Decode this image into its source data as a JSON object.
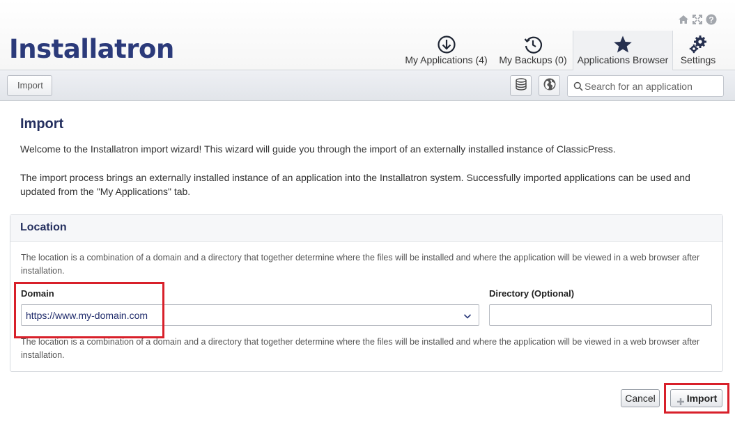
{
  "app": {
    "logo_text": "Installatron"
  },
  "tabs": [
    {
      "label": "My Applications (4)",
      "icon": "download-circle-icon"
    },
    {
      "label": "My Backups (0)",
      "icon": "history-clock-icon"
    },
    {
      "label": "Applications Browser",
      "icon": "star-icon",
      "active": true
    },
    {
      "label": "Settings",
      "icon": "gears-icon"
    }
  ],
  "top_icons": [
    "home-icon",
    "fullscreen-icon",
    "help-icon"
  ],
  "toolbar": {
    "breadcrumb": "Import",
    "db_button_icon": "database-icon",
    "language_button_icon": "globe-icon",
    "search_placeholder": "Search for an application"
  },
  "page": {
    "title": "Import",
    "intro1": "Welcome to the Installatron import wizard! This wizard will guide you through the import of an externally installed instance of ClassicPress.",
    "intro2": "The import process brings an externally installed instance of an application into the Installatron system. Successfully imported applications can be used and updated from the \"My Applications\" tab."
  },
  "location": {
    "title": "Location",
    "help_top": "The location is a combination of a domain and a directory that together determine where the files will be installed and where the application will be viewed in a web browser after installation.",
    "domain_label": "Domain",
    "domain_value": "https://www.my-domain.com",
    "directory_label": "Directory (Optional)",
    "directory_value": "",
    "help_bottom": "The location is a combination of a domain and a directory that together determine where the files will be installed and where the application will be viewed in a web browser after installation."
  },
  "actions": {
    "cancel_label": "Cancel",
    "import_label": "Import"
  },
  "colors": {
    "accent": "#25305f",
    "highlight": "#d8202a",
    "link_blue": "#1f2b6b"
  }
}
